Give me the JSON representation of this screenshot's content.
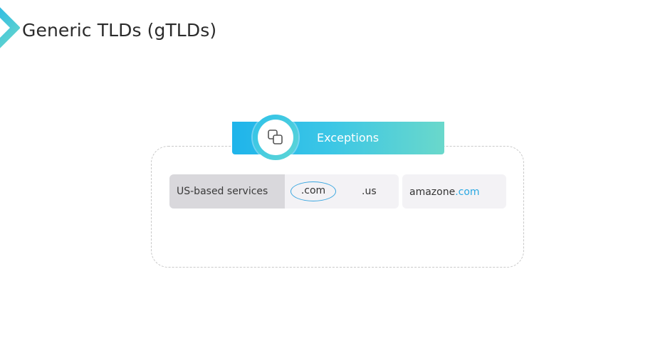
{
  "header": {
    "title": "Generic TLDs (gTLDs)"
  },
  "ribbon": {
    "label": "Exceptions",
    "icon": "copy-squares-icon"
  },
  "rule_row": {
    "label": "US-based services",
    "tld_circled": ".com",
    "tld_other": ".us"
  },
  "example": {
    "domain_name": "amazone",
    "domain_tld": ".com"
  },
  "colors": {
    "accent": "#2aa8e2",
    "ribbon_start": "#1fb4ea",
    "ribbon_end": "#6ad8cb",
    "label_bg": "#d9d8dc",
    "cell_bg": "#f3f2f5"
  }
}
